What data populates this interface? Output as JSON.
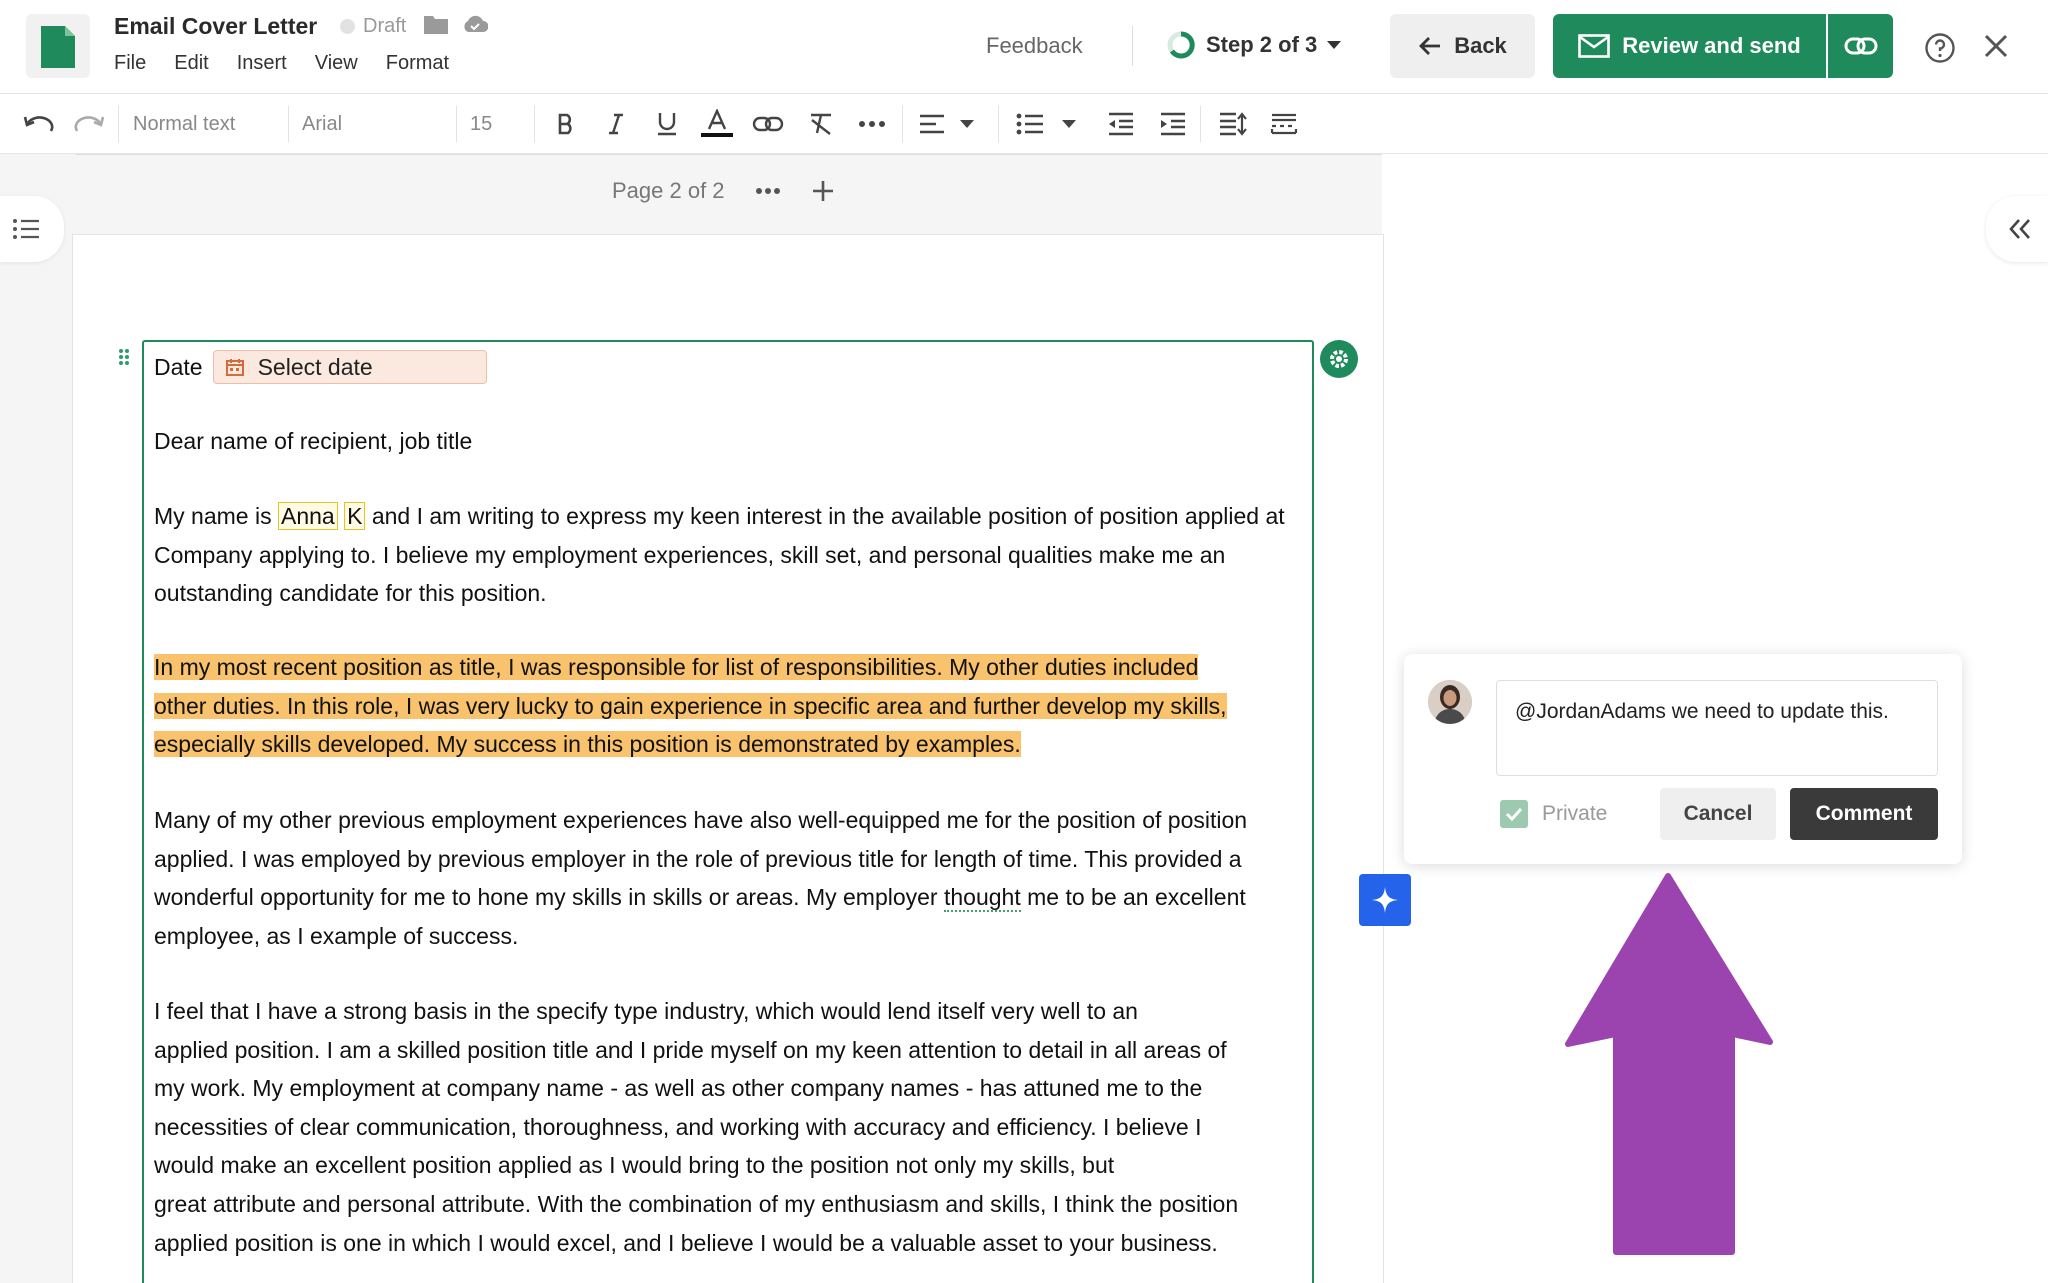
{
  "header": {
    "doc_title": "Email Cover Letter",
    "status": "Draft",
    "menu": [
      "File",
      "Edit",
      "Insert",
      "View",
      "Format"
    ],
    "feedback": "Feedback",
    "step": "Step 2 of 3",
    "back": "Back",
    "review_send": "Review and send"
  },
  "toolbar": {
    "style": "Normal text",
    "font": "Arial",
    "size": "15"
  },
  "page": {
    "label": "Page 2 of 2"
  },
  "document": {
    "date_label": "Date",
    "date_placeholder": "Select date",
    "salutation": "Dear name of recipient, job title",
    "p1_a": "My name is ",
    "p1_field1": "Anna",
    "p1_field2": "K",
    "p1_b": " and I am writing to express my keen interest in the available position of position applied at Company applying to. I believe my employment experiences, skill set, and personal qualities make me an outstanding candidate for this position.",
    "p2_l1": "In my most recent position as title, I was responsible for list of responsibilities. My other duties included",
    "p2_l2": "other duties. In this role, I was very lucky to gain experience in specific area and further develop my skills,",
    "p2_l3": "especially skills developed. My success in this position is demonstrated by examples.",
    "p3_a": "Many of my other previous employment experiences have also well-equipped me for the position of position applied. I was employed by  previous employer in the role of previous title for length of time. This provided a wonderful opportunity for me to hone my skills in skills or areas. My employer ",
    "p3_word": "thought",
    "p3_b": " me to be an excellent employee, as I example of success.",
    "p4_l1": "I feel that I have a strong basis in the specify type industry, which would lend itself very well to an",
    "p4_l2": "applied position. I am a skilled position title and I pride myself on my keen attention to detail in all areas of",
    "p4_l3": "my work. My employment at company name - as well as other company names - has attuned me to the",
    "p4_l4": "necessities of clear communication, thoroughness, and working with accuracy and efficiency. I believe I",
    "p4_l5": "would make an excellent position applied as I would bring to the position not only my skills, but",
    "p4_l6": "great attribute and personal attribute. With the combination of my enthusiasm and skills, I think the position",
    "p4_l7": "applied position is one in which I would excel, and I believe I would be a valuable asset to your business."
  },
  "comment": {
    "text": "@JordanAdams we need to update this.",
    "private_label": "Private",
    "private_checked": true,
    "cancel": "Cancel",
    "submit": "Comment"
  },
  "colors": {
    "brand_green": "#1f8a5b",
    "highlight": "#f9c36d",
    "arrow": "#9b43ae",
    "ai_button": "#2563eb"
  }
}
